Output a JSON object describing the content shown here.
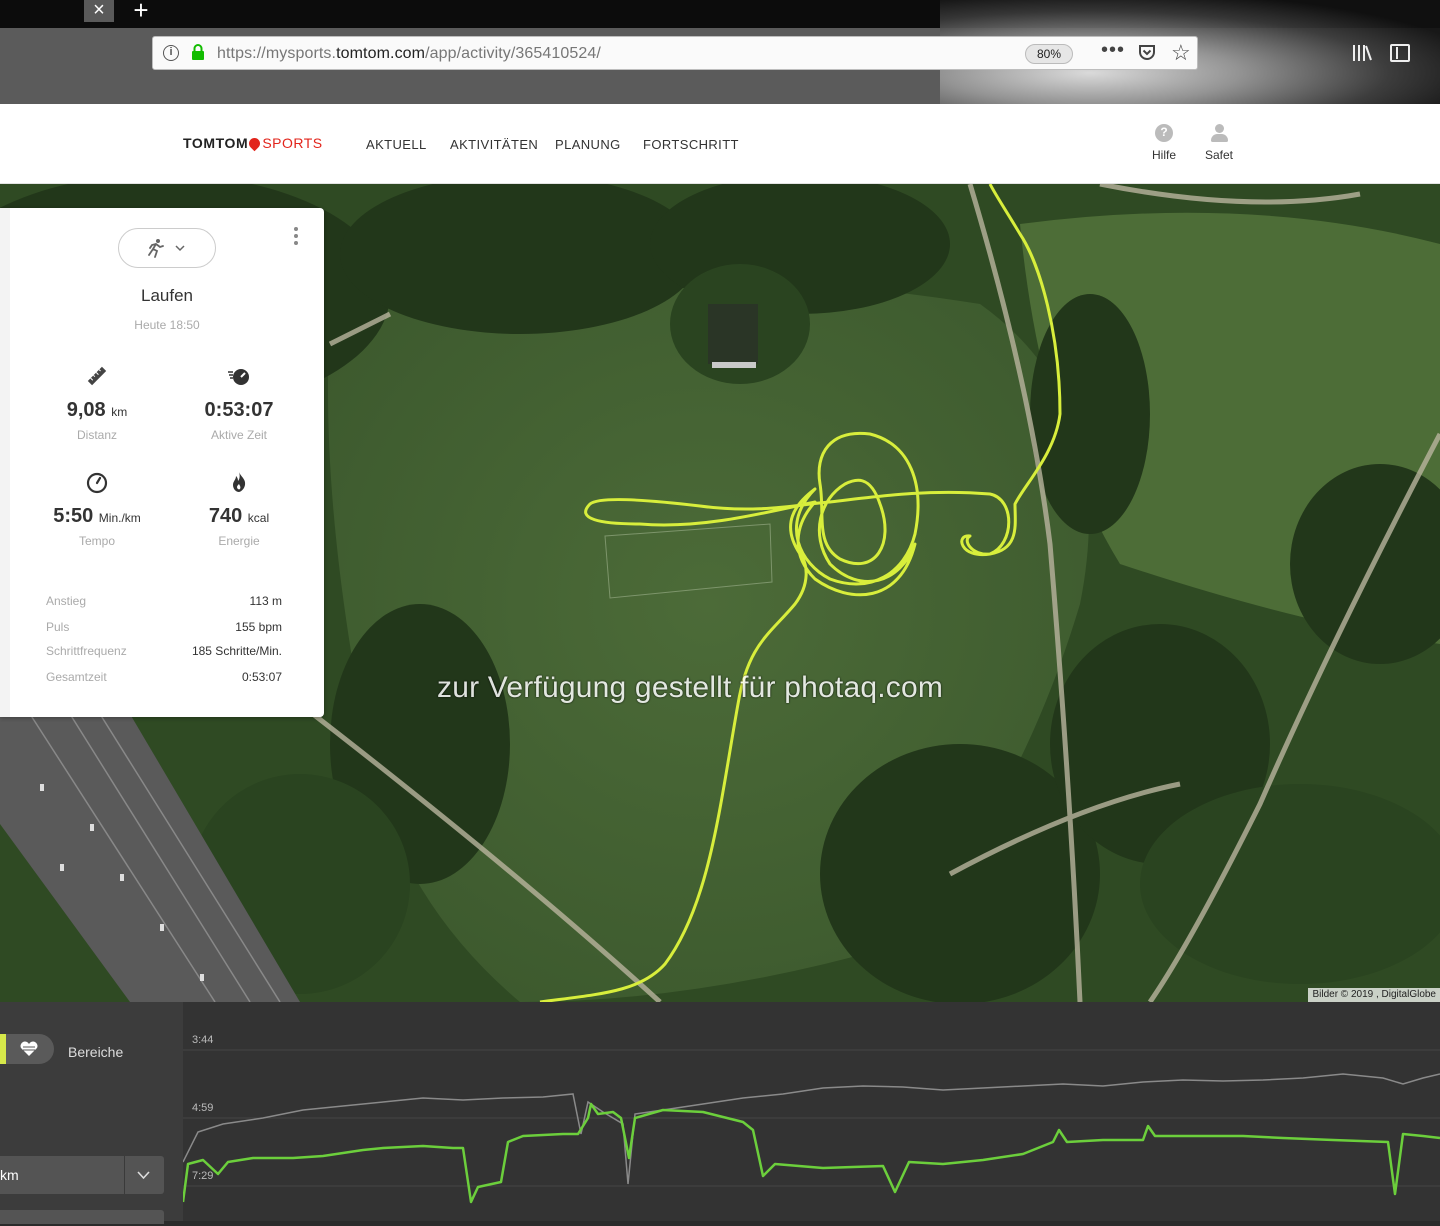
{
  "browser": {
    "tab_close": "×",
    "tab_new": "+",
    "url_prefix": "https://mysports.",
    "url_domain": "tomtom.com",
    "url_path": "/app/activity/365410524/",
    "zoom": "80%",
    "more": "•••",
    "star": "☆"
  },
  "header": {
    "logo_brand": "TOMTOM",
    "logo_product": "SPORTS",
    "nav": [
      "AKTUELL",
      "AKTIVITÄTEN",
      "PLANUNG",
      "FORTSCHRITT"
    ],
    "help_label": "Hilfe",
    "user_label": "Safet"
  },
  "activity": {
    "title": "Laufen",
    "subtitle": "Heute 18:50",
    "stats": [
      {
        "value": "9,08",
        "unit": "km",
        "label": "Distanz",
        "icon": "ruler-icon"
      },
      {
        "value": "0:53:07",
        "unit": "",
        "label": "Aktive Zeit",
        "icon": "stopwatch-icon"
      },
      {
        "value": "5:50",
        "unit": "Min./km",
        "label": "Tempo",
        "icon": "speedometer-icon"
      },
      {
        "value": "740",
        "unit": "kcal",
        "label": "Energie",
        "icon": "flame-icon"
      }
    ],
    "details": [
      {
        "key": "Anstieg",
        "value": "113  m"
      },
      {
        "key": "Puls",
        "value": "155  bpm"
      },
      {
        "key": "Schrittfrequenz",
        "value": "185 Schritte/Min."
      },
      {
        "key": "Gesamtzeit",
        "value": "0:53:07"
      }
    ]
  },
  "map": {
    "watermark": "zur Verfügung gestellt für photaq.com",
    "credit": "Bilder © 2019 , DigitalGlobe",
    "route_color": "#d8ee3c"
  },
  "bottom_panel": {
    "bereiche_label": "Bereiche",
    "unit_value": "km",
    "y_ticks": [
      "3:44",
      "4:59",
      "7:29"
    ]
  },
  "colors": {
    "pace_line": "#6ccf3c",
    "secondary_line": "#8a8a8a",
    "accent": "#d6e84a",
    "brand_red": "#e2241b"
  }
}
